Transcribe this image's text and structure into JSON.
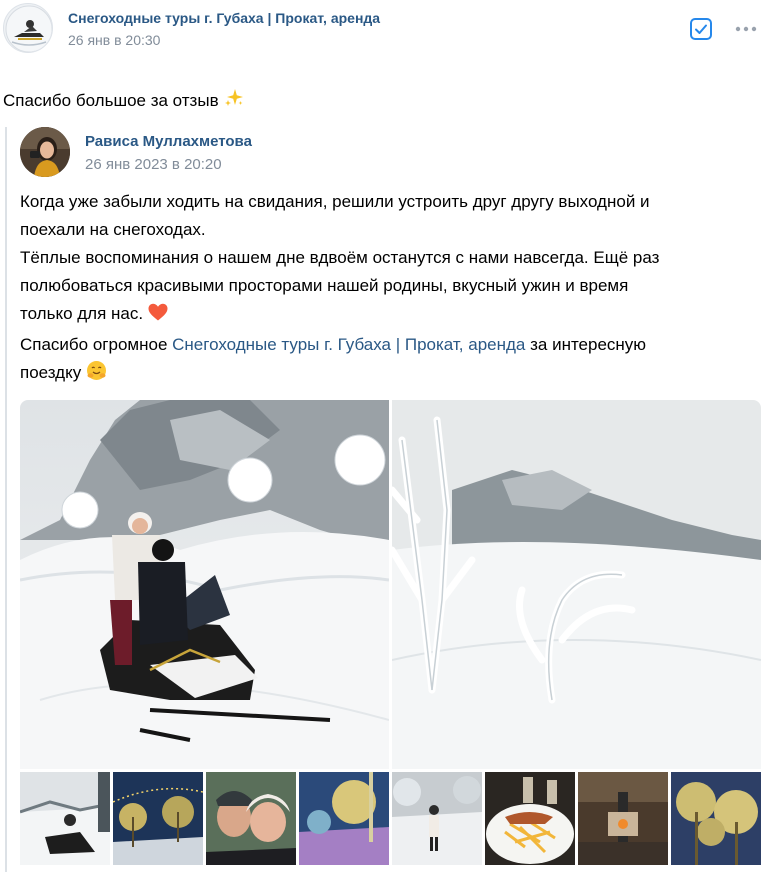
{
  "post": {
    "group_name": "Снегоходные туры г. Губаха | Прокат, аренда",
    "date": "26 янв в 20:30",
    "text": "Спасибо большое за отзыв"
  },
  "repost": {
    "author": "Рависа Муллахметова",
    "date": "26 янв 2023 в 20:20",
    "line1": "Когда уже забыли ходить на свидания, решили устроить друг другу выходной и",
    "line2": "поехали на снегоходах.",
    "line3": "Тёплые воспоминания о нашем дне вдвоём останутся с нами навсегда. Ещё раз",
    "line4": "полюбоваться красивыми просторами нашей родины, вкусный ужин и время",
    "line5": "только для нас.",
    "line6_prefix": "Спасибо огромное ",
    "line6_link": "Снегоходные туры г. Губаха | Прокат, аренда",
    "line6_suffix": " за интересную",
    "line7": "поездку"
  },
  "icons": {
    "check": "checkbox-icon",
    "more": "more-icon",
    "sparkle": "sparkles-emoji",
    "heart": "heart-emoji",
    "smile": "hugging-face-emoji"
  },
  "colors": {
    "link": "#2a5885",
    "secondary": "#818c99",
    "accent": "#2688eb"
  }
}
